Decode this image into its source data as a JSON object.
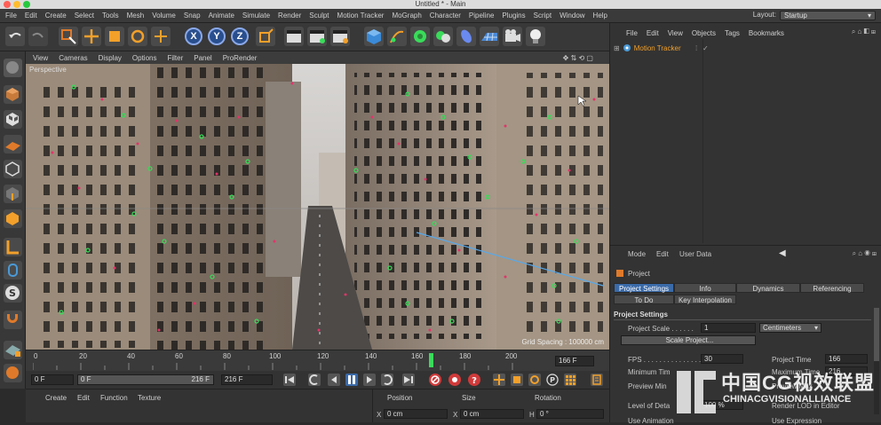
{
  "window": {
    "title": "Untitled * - Main"
  },
  "menu": [
    "File",
    "Edit",
    "Create",
    "Select",
    "Tools",
    "Mesh",
    "Volume",
    "Snap",
    "Animate",
    "Simulate",
    "Render",
    "Sculpt",
    "Motion Tracker",
    "MoGraph",
    "Character",
    "Pipeline",
    "Plugins",
    "Script",
    "Window",
    "Help"
  ],
  "layout": {
    "label": "Layout:",
    "value": "Startup"
  },
  "toolbar": {
    "x": "X",
    "y": "Y",
    "z": "Z"
  },
  "viewport": {
    "menu": [
      "View",
      "Cameras",
      "Display",
      "Options",
      "Filter",
      "Panel",
      "ProRender"
    ],
    "label": "Perspective",
    "grid_spacing": "Grid Spacing : 100000 cm"
  },
  "timeline": {
    "ticks": [
      "0",
      "20",
      "40",
      "60",
      "80",
      "100",
      "120",
      "140",
      "160",
      "180",
      "200"
    ],
    "end_label": "166 F",
    "current_frame": 166,
    "range_max": 200
  },
  "playback": {
    "start": "0 F",
    "min": "0 F",
    "max_inner": "216 F",
    "max": "216 F"
  },
  "materials": {
    "menu": [
      "Create",
      "Edit",
      "Function",
      "Texture"
    ]
  },
  "coordinates": {
    "headers": [
      "Position",
      "Size",
      "Rotation"
    ],
    "x_pos_label": "X",
    "x_pos": "0 cm",
    "x_size_label": "X",
    "x_size": "0 cm",
    "h_rot_label": "H",
    "h_rot": "0 °"
  },
  "objects": {
    "menu": [
      "File",
      "Edit",
      "View",
      "Objects",
      "Tags",
      "Bookmarks"
    ],
    "items": [
      {
        "name": "Motion Tracker"
      }
    ]
  },
  "attributes": {
    "menu": [
      "Mode",
      "Edit",
      "User Data"
    ],
    "object_label": "Project",
    "tabs_row1": [
      "Project Settings",
      "Info",
      "Dynamics",
      "Referencing"
    ],
    "tabs_row2": [
      "To Do",
      "Key Interpolation"
    ],
    "section_title": "Project Settings",
    "project_scale_label": "Project Scale . . . . . .",
    "project_scale_value": "1",
    "project_scale_unit": "Centimeters",
    "scale_button": "Scale Project...",
    "fps_label": "FPS . . . . . . . . . . . . . . .",
    "fps_value": "30",
    "project_time_label": "Project Time",
    "project_time_value": "166",
    "min_time_label": "Minimum Tim",
    "max_time_label": "Maximum Time",
    "max_time_value": "216",
    "preview_min_label": "Preview Min",
    "preview_max_label": "Preview Max",
    "lod_label": "Level of Deta",
    "lod_value": "100 %",
    "render_lod_label": "Render LOD in Editor",
    "use_animation_label": "Use Animation",
    "use_expression_label": "Use Expression"
  },
  "watermark": {
    "cn": "中国CG视效联盟",
    "en": "CHINACGVISIONALLIANCE"
  },
  "colors": {
    "accent": "#3a6aa8",
    "selected_tab": "#3a6aa8",
    "marker_green": "#3adb5a",
    "marker_red": "#e0346a"
  }
}
